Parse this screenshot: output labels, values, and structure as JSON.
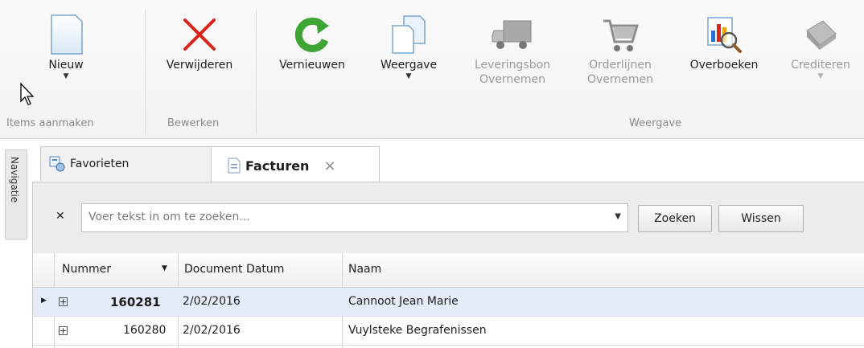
{
  "ribbon": {
    "groups": [
      {
        "label": "Items aanmaken"
      },
      {
        "label": "Bewerken"
      },
      {
        "label": "Weergave"
      }
    ],
    "buttons": [
      {
        "label": "Nieuw",
        "icon": "new-page-icon",
        "disabled": false,
        "dropdown": true
      },
      {
        "label": "Verwijderen",
        "icon": "delete-x-icon",
        "disabled": false,
        "dropdown": false
      },
      {
        "label": "Vernieuwen",
        "icon": "refresh-icon",
        "disabled": false,
        "dropdown": false
      },
      {
        "label": "Weergave",
        "icon": "view-pages-icon",
        "disabled": false,
        "dropdown": true
      },
      {
        "label": "Leveringsbon",
        "label2": "Overnemen",
        "icon": "delivery-truck-icon",
        "disabled": true,
        "dropdown": false
      },
      {
        "label": "Orderlijnen",
        "label2": "Overnemen",
        "icon": "shopping-cart-icon",
        "disabled": true,
        "dropdown": false
      },
      {
        "label": "Overboeken",
        "icon": "chart-magnifier-icon",
        "disabled": false,
        "dropdown": false
      },
      {
        "label": "Crediteren",
        "icon": "credit-book-icon",
        "disabled": true,
        "dropdown": true
      }
    ]
  },
  "sidenav": {
    "label": "Navigatie"
  },
  "tabs": [
    {
      "label": "Favorieten",
      "icon": "favorites-icon",
      "active": false
    },
    {
      "label": "Facturen",
      "icon": "invoice-icon",
      "active": true,
      "close": "×"
    }
  ],
  "search": {
    "clear": "✕",
    "placeholder": "Voer tekst in om te zoeken...",
    "search_button": "Zoeken",
    "clear_button": "Wissen"
  },
  "grid": {
    "columns": [
      "Nummer",
      "Document Datum",
      "Naam"
    ],
    "rows": [
      {
        "nummer": "160281",
        "datum": "2/02/2016",
        "naam": "Cannoot Jean Marie",
        "selected": true
      },
      {
        "nummer": "160280",
        "datum": "2/02/2016",
        "naam": "Vuylsteke Begrafenissen",
        "selected": false
      }
    ]
  },
  "colors": {
    "accent_red": "#d9241c",
    "accent_green": "#3fa535",
    "selection": "#e4ecf8"
  }
}
